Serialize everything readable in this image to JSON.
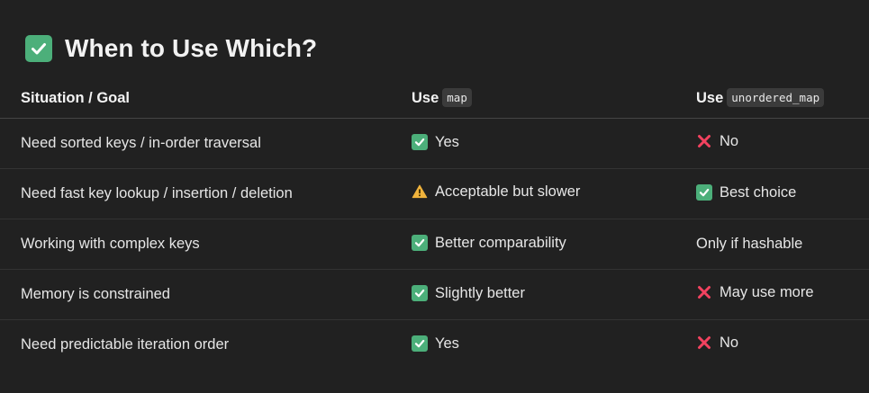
{
  "heading": {
    "icon": "check-mark-button-icon",
    "title": "When to Use Which?"
  },
  "table": {
    "headers": {
      "situation": "Situation / Goal",
      "map_prefix": "Use",
      "map_code": "map",
      "umap_prefix": "Use",
      "umap_code": "unordered_map"
    },
    "rows": [
      {
        "situation": "Need sorted keys / in-order traversal",
        "map": {
          "icon": "check-icon",
          "text": "Yes"
        },
        "umap": {
          "icon": "cross-icon",
          "text": "No"
        }
      },
      {
        "situation": "Need fast key lookup / insertion / deletion",
        "map": {
          "icon": "warning-icon",
          "text": "Acceptable but slower"
        },
        "umap": {
          "icon": "check-icon",
          "text": "Best choice"
        }
      },
      {
        "situation": "Working with complex keys",
        "map": {
          "icon": "check-icon",
          "text": "Better comparability"
        },
        "umap": {
          "icon": "",
          "text": "Only if hashable"
        }
      },
      {
        "situation": "Memory is constrained",
        "map": {
          "icon": "check-icon",
          "text": "Slightly better"
        },
        "umap": {
          "icon": "cross-icon",
          "text": "May use more"
        }
      },
      {
        "situation": "Need predictable iteration order",
        "map": {
          "icon": "check-icon",
          "text": "Yes"
        },
        "umap": {
          "icon": "cross-icon",
          "text": "No"
        }
      }
    ]
  },
  "colors": {
    "background": "#212121",
    "check": "#4caf7a",
    "cross": "#f2425f",
    "warning": "#f0b33c"
  }
}
